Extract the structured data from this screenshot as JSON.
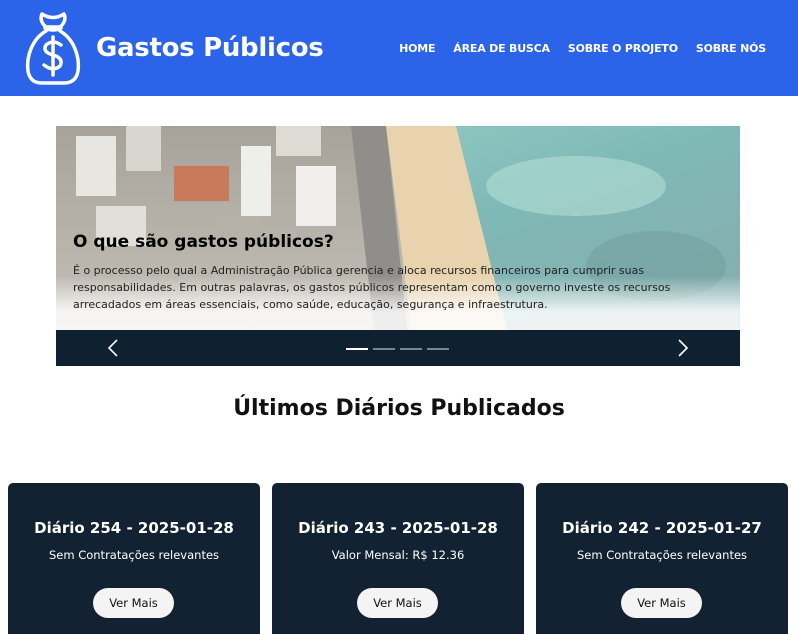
{
  "header": {
    "brand": "Gastos Públicos",
    "nav": [
      "HOME",
      "ÁREA DE BUSCA",
      "SOBRE O PROJETO",
      "SOBRE NÓS"
    ]
  },
  "carousel": {
    "title": "O que são gastos públicos?",
    "text": "É o processo pelo qual a Administração Pública gerencia e aloca recursos financeiros para cumprir suas responsabilidades. Em outras palavras, os gastos públicos representam como o governo investe os recursos arrecadados em áreas essenciais, como saúde, educação, segurança e infraestrutura.",
    "slide_count": 4,
    "active_slide": 1
  },
  "section": {
    "title": "Últimos Diários Publicados"
  },
  "cards": [
    {
      "title": "Diário 254 - 2025-01-28",
      "subtitle": "Sem Contratações relevantes",
      "button": "Ver Mais"
    },
    {
      "title": "Diário 243 - 2025-01-28",
      "subtitle": "Valor Mensal: R$ 12.36",
      "button": "Ver Mais"
    },
    {
      "title": "Diário 242 - 2025-01-27",
      "subtitle": "Sem Contratações relevantes",
      "button": "Ver Mais"
    }
  ],
  "colors": {
    "header": "#2b63e9",
    "dark": "#122232",
    "white": "#ffffff"
  },
  "icons": {
    "logo": "money-bag-icon",
    "prev": "chevron-left-icon",
    "next": "chevron-right-icon"
  }
}
